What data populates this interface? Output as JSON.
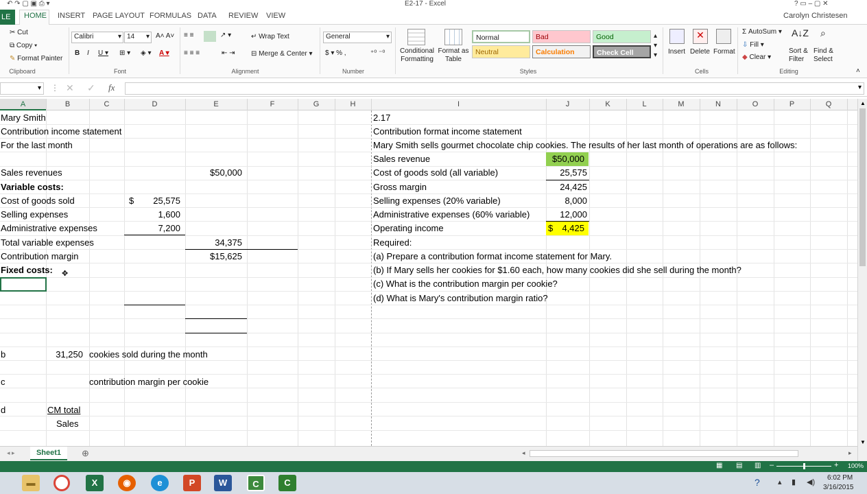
{
  "window": {
    "title": "E2-17 - Excel",
    "user": "Carolyn Christesen"
  },
  "ribbon_tabs": [
    "FILE",
    "HOME",
    "INSERT",
    "PAGE LAYOUT",
    "FORMULAS",
    "DATA",
    "REVIEW",
    "VIEW"
  ],
  "ribbon": {
    "clipboard": {
      "cut": "Cut",
      "copy": "Copy",
      "format_painter": "Format Painter",
      "label": "Clipboard"
    },
    "font": {
      "name": "Calibri",
      "size": "14",
      "label": "Font"
    },
    "alignment": {
      "wrap": "Wrap Text",
      "merge": "Merge & Center",
      "label": "Alignment"
    },
    "number": {
      "format": "General",
      "label": "Number"
    },
    "styles": {
      "conditional": "Conditional Formatting",
      "format_table": "Format as Table",
      "normal": "Normal",
      "bad": "Bad",
      "good": "Good",
      "neutral": "Neutral",
      "calculation": "Calculation",
      "check_cell": "Check Cell",
      "label": "Styles"
    },
    "cells": {
      "insert": "Insert",
      "delete": "Delete",
      "format": "Format",
      "label": "Cells"
    },
    "editing": {
      "autosum": "AutoSum",
      "fill": "Fill",
      "clear": "Clear",
      "sort": "Sort & Filter",
      "find": "Find & Select",
      "label": "Editing"
    }
  },
  "formula_bar": {
    "fx": "fx",
    "content": ""
  },
  "columns": [
    "A",
    "B",
    "C",
    "D",
    "E",
    "F",
    "G",
    "H",
    "I",
    "J",
    "K",
    "L",
    "M",
    "N",
    "O",
    "P",
    "Q"
  ],
  "cells": {
    "a1": "Mary Smith",
    "a2": "Contribution income statement",
    "a3": "For the last month",
    "a5": "Sales revenues",
    "e5": "$50,000",
    "a6": "Variable costs:",
    "a7": "Cost of goods sold",
    "d7_sym": "$",
    "d7": "25,575",
    "a8": "Selling expenses",
    "d8": "1,600",
    "a9": "Administrative expenses",
    "d9": "7,200",
    "a10": "Total variable expenses",
    "e10": "34,375",
    "a11": "Contribution margin",
    "e11": "$15,625",
    "a12": "Fixed costs:",
    "a18": "b",
    "b18": "31,250",
    "c18": "cookies sold during the month",
    "a20": "c",
    "c20": "contribution margin per cookie",
    "a22": "d",
    "b22": "CM total",
    "b23": "Sales",
    "i1": "2.17",
    "i2": "Contribution format income statement",
    "i3": "Mary Smith sells gourmet chocolate chip cookies. The results of her last month of operations are as follows:",
    "i4": "Sales revenue",
    "j4": "$50,000",
    "i5": "Cost of goods sold (all variable)",
    "j5": "25,575",
    "i6": "Gross margin",
    "j6": "24,425",
    "i7": "Selling expenses (20% variable)",
    "j7": "8,000",
    "i8": "Administrative expenses (60% variable)",
    "j8": "12,000",
    "i9": "Operating income",
    "j9_sym": "$",
    "j9": "4,425",
    "i10": "Required:",
    "i11": "(a)  Prepare a contribution format income statement for Mary.",
    "i12": "(b)  If Mary sells her cookies for $1.60 each, how many cookies did she sell during the month?",
    "i13": "(c)  What is the contribution margin per cookie?",
    "i14": "(d)  What is Mary's contribution margin ratio?"
  },
  "sheet_tab": "Sheet1",
  "status": {
    "zoom": "100%"
  },
  "clock": {
    "time": "6:02 PM",
    "date": "3/16/2015"
  },
  "colors": {
    "excel_green": "#217346",
    "highlight_green": "#92d050",
    "highlight_yellow": "#ffff00"
  }
}
